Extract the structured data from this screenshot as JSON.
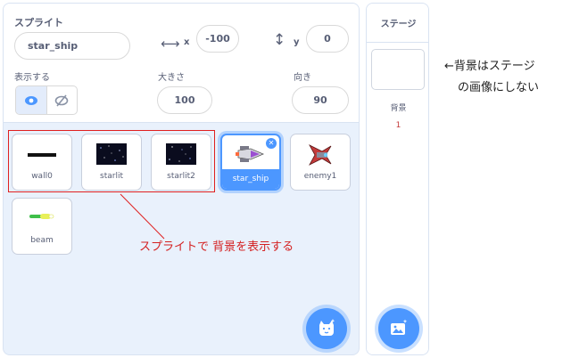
{
  "sprite_info": {
    "sprite_label": "スプライト",
    "sprite_name": "star_ship",
    "x_label": "x",
    "x_value": "-100",
    "y_label": "y",
    "y_value": "0",
    "show_label": "表示する",
    "size_label": "大きさ",
    "size_value": "100",
    "direction_label": "向き",
    "direction_value": "90"
  },
  "sprites": [
    {
      "name": "wall0",
      "thumb": "black-bar",
      "selected": false
    },
    {
      "name": "starlit",
      "thumb": "starfield",
      "selected": false
    },
    {
      "name": "starlit2",
      "thumb": "starfield",
      "selected": false
    },
    {
      "name": "star_ship",
      "thumb": "spaceship",
      "selected": true
    },
    {
      "name": "enemy1",
      "thumb": "enemy-ship",
      "selected": false
    },
    {
      "name": "beam",
      "thumb": "beam",
      "selected": false
    }
  ],
  "annotation": "スプライトで 背景を表示する",
  "stage": {
    "title": "ステージ",
    "backdrop_label": "背景",
    "backdrop_count": "1"
  },
  "side_note": {
    "line1": "←背景はステージ",
    "line2": "の画像にしない"
  },
  "colors": {
    "accent": "#4c97ff",
    "annotation": "#d42020",
    "pane_bg": "#e9f1fc"
  }
}
